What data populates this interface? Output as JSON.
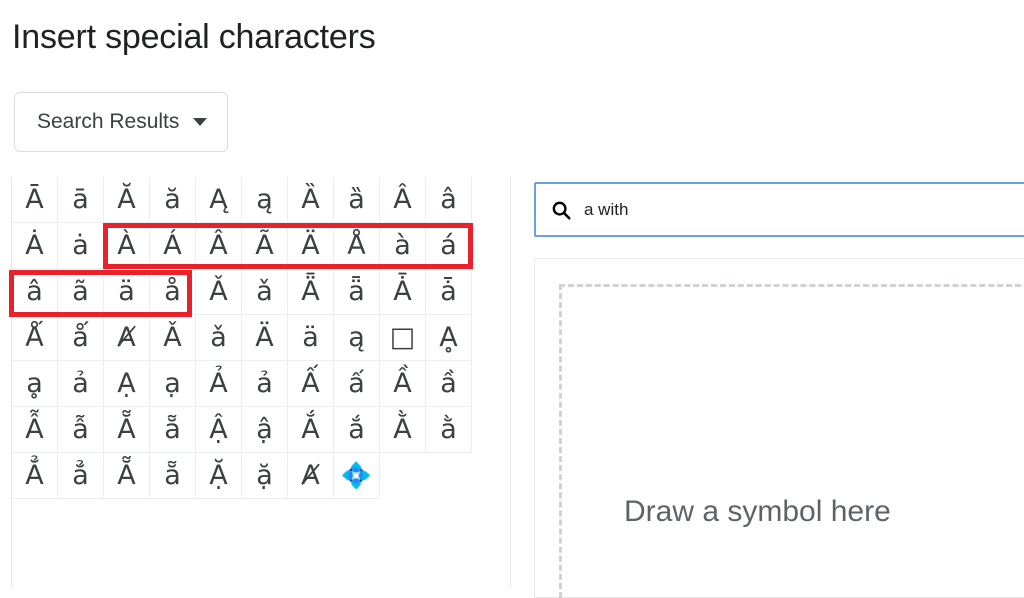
{
  "page": {
    "title": "Insert special characters"
  },
  "category_dropdown": {
    "label": "Search Results",
    "caret_icon": "chevron-down-icon"
  },
  "search": {
    "icon": "search-icon",
    "value": "a with",
    "placeholder": "",
    "focused": true,
    "focus_border_color": "#6b9eec"
  },
  "draw_panel": {
    "hint": "Draw a symbol here",
    "dashed_border_color": "#cfd3d6"
  },
  "annotations": {
    "highlight_color": "#e8212b",
    "boxes": [
      {
        "name": "highlight-row-2-cols-3-to-10",
        "row": 2,
        "col_start": 3,
        "col_end": 10
      },
      {
        "name": "highlight-row-3-cols-1-to-4",
        "row": 3,
        "col_start": 1,
        "col_end": 4
      }
    ]
  },
  "char_grid": {
    "columns": 10,
    "rows": 7,
    "cells": [
      "Ā",
      "ā",
      "Ă",
      "ă",
      "Ą",
      "ą",
      "Ȁ",
      "ȁ",
      "Â",
      "â",
      "Ȧ",
      "ȧ",
      "À",
      "Á",
      "Â",
      "Ã",
      "Ä",
      "Å",
      "à",
      "á",
      "â",
      "ã",
      "ä",
      "å",
      "Ǎ",
      "ǎ",
      "Ǟ",
      "ǟ",
      "Ǡ",
      "ǡ",
      "Ǻ",
      "ǻ",
      "Ⱥ",
      "Ǎ",
      "ǎ",
      "Ä",
      "ä",
      "ą",
      "□",
      "Ḁ",
      "ḁ",
      "ả",
      "Ạ",
      "ạ",
      "Ả",
      "ả",
      "Ấ",
      "ấ",
      "Ầ",
      "ầ",
      "Ẫ",
      "ẫ",
      "Ẵ",
      "ẵ",
      "Ậ",
      "ậ",
      "Ắ",
      "ắ",
      "Ằ",
      "ằ",
      "Ẳ",
      "ẳ",
      "Ẵ",
      "ẵ",
      "Ặ",
      "ặ",
      "Ⱥ",
      "💠"
    ]
  }
}
